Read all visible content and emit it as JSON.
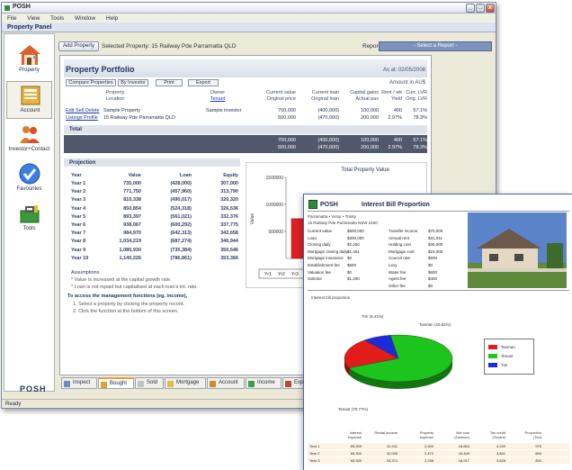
{
  "window": {
    "title": "POSH",
    "min": "_",
    "max": "□",
    "close": "x"
  },
  "menu": [
    "File",
    "View",
    "Tools",
    "Window",
    "Help"
  ],
  "panel": {
    "title": "Property Panel"
  },
  "sidebar": {
    "items": [
      {
        "label": "Property",
        "icon": "house-icon"
      },
      {
        "label": "Account",
        "icon": "account-book-icon"
      },
      {
        "label": "Investor+Contact",
        "icon": "people-icon"
      },
      {
        "label": "Favourites",
        "icon": "checkmark-icon"
      },
      {
        "label": "Tools",
        "icon": "toolbox-icon"
      }
    ],
    "logo": "POSH"
  },
  "toolbar": {
    "add_property": "Add Property",
    "selected_property": "Selected Property: 15 Railway Pde Parramatta QLD",
    "report_label": "Report:",
    "report_select": "- Select a Report -"
  },
  "portfolio": {
    "title": "Property Portfolio",
    "as_at": "As at: 02/05/2008",
    "amount_in": "Amount in AU$",
    "buttons": [
      "Compare Properties",
      "By Investor",
      "Print",
      "Export"
    ],
    "columns": {
      "property": "Property",
      "location": "Location",
      "owner": "Owner",
      "tenant": "Tenant",
      "current_value": "Current value",
      "original_price": "Original price",
      "current_loan": "Current loan",
      "original_loan": "Original loan",
      "capital_gains": "Capital gains",
      "actual_pav": "Actual pav",
      "rent_wk": "Rent / wk",
      "yield": "Yield",
      "curr_lvr": "Curr. LVR",
      "orig_lvr": "Orig. LVR"
    },
    "row": {
      "actions1": "Edit Sell Delete",
      "actions2": "Listings Profile",
      "property": "Sample Property",
      "location": "15 Railway Pde Parramatta QLD",
      "owner": "Sample investor",
      "current_value": "700,000",
      "original_price": "600,000",
      "current_loan": "(400,000)",
      "original_loan": "(470,000)",
      "capital_gains": "100,000",
      "actual_pav": "200,000",
      "rent_wk": "400",
      "yield": "2.97%",
      "curr_lvr": "57.1%",
      "orig_lvr": "78.3%"
    },
    "total": {
      "label": "Total",
      "current_value": "700,000",
      "original_price": "600,000",
      "current_loan": "(400,000)",
      "original_loan": "(470,000)",
      "capital_gains": "100,000",
      "actual_pav": "200,000",
      "rent_wk": "400",
      "yield": "2.97%",
      "curr_lvr": "57.1%",
      "orig_lvr": "78.3%"
    }
  },
  "projection": {
    "title": "Projection",
    "headers": [
      "Year",
      "Value",
      "Loan",
      "Equity"
    ],
    "rows": [
      [
        "Year 1",
        "735,000",
        "(428,000)",
        "307,000"
      ],
      [
        "Year 2",
        "771,750",
        "(457,960)",
        "313,790"
      ],
      [
        "Year 3",
        "810,338",
        "(490,017)",
        "320,320"
      ],
      [
        "Year 4",
        "850,854",
        "(524,318)",
        "326,536"
      ],
      [
        "Year 5",
        "893,397",
        "(561,021)",
        "332,376"
      ],
      [
        "Year 6",
        "938,067",
        "(600,292)",
        "337,775"
      ],
      [
        "Year 7",
        "984,970",
        "(642,313)",
        "342,658"
      ],
      [
        "Year 8",
        "1,034,219",
        "(687,274)",
        "346,944"
      ],
      [
        "Year 9",
        "1,085,930",
        "(735,384)",
        "350,546"
      ],
      [
        "Year 10",
        "1,140,226",
        "(786,861)",
        "353,366"
      ]
    ],
    "assumptions_title": "Assumptions",
    "assumptions": [
      "* Value is increased at the capital growth rate.",
      "* Loan is not repaid but capitalised at each loan's int. rate."
    ]
  },
  "management": {
    "title": "To access the management functions (eg. income),",
    "steps": [
      "1. Select a property by clicking the property record.",
      "2. Click the function at the bottom of this screen."
    ]
  },
  "chart_data": {
    "type": "bar",
    "title": "Total Property Value",
    "ylabel": "Value",
    "yticks": [
      "1500000",
      "1000000",
      "500000"
    ],
    "categories": [
      "Yr1",
      "Yr2",
      "Yr3"
    ],
    "values": [
      735000,
      771750,
      810338
    ],
    "ylim": [
      0,
      1500000
    ],
    "color": "#e02020"
  },
  "tabs": [
    {
      "label": "Inspect",
      "icon": "inspect-icon"
    },
    {
      "label": "Bought",
      "icon": "bought-icon",
      "active": true
    },
    {
      "label": "Sold",
      "icon": "sold-icon"
    },
    {
      "label": "Mortgage",
      "icon": "mortgage-icon"
    },
    {
      "label": "Account",
      "icon": "account-icon"
    },
    {
      "label": "Income",
      "icon": "income-icon"
    },
    {
      "label": "Expen",
      "icon": "expense-icon"
    }
  ],
  "status": "Ready",
  "report": {
    "brand": "POSH",
    "title": "Interest Bill Proportion",
    "address1": "Parramatta • Victor • Trinity",
    "address2": "15 Railway Pde Parramatta NSW 2150",
    "left_kv": [
      [
        "Current value",
        "$600,000"
      ],
      [
        "Loan",
        "$300,000"
      ],
      [
        "Closing daily",
        "$2,250"
      ],
      [
        "Mortgage closing daily",
        "$1,451"
      ],
      [
        "Mortgage insurance",
        "$0"
      ],
      [
        "Establishment fee",
        "$600"
      ],
      [
        "Valuation fee",
        "$0"
      ],
      [
        "Solicitor",
        "$1,200"
      ]
    ],
    "mid_kv": [
      [
        "Transfer income",
        "$70,000"
      ],
      [
        "Annual rent",
        "$31,011"
      ],
      [
        "Holding cost",
        "$40,000"
      ],
      [
        "Mortgage cost",
        "$23,000"
      ],
      [
        "Council rate",
        "$600"
      ],
      [
        "Levy",
        "$0"
      ],
      [
        "Water fee",
        "$600"
      ],
      [
        "Agent fee",
        "$400"
      ],
      [
        "Other fee",
        "$0"
      ]
    ],
    "pie_title": "Interest bill proportion",
    "pie_labels": [
      "Tim (8.41%)",
      "Taxman (20.82%)",
      "Tenant (70.77%)"
    ],
    "chart_data": {
      "type": "pie",
      "title": "Interest bill proportion",
      "slices": [
        {
          "name": "Tenant",
          "value": 70.77,
          "color": "#1ec41e"
        },
        {
          "name": "Taxman",
          "value": 20.82,
          "color": "#e21b1b"
        },
        {
          "name": "Tim",
          "value": 8.41,
          "color": "#1d2bd8"
        }
      ]
    },
    "legend": [
      "Taxman",
      "Tenant",
      "Tim"
    ],
    "table_headers": [
      "Interest expense",
      "Rental income",
      "Property expense",
      "Net cost (Taxman)",
      "Tax credit (Tenant)",
      "Proportion (Tim)"
    ],
    "table_rows": [
      [
        "Year 1",
        "65,300",
        "31,011",
        "2,400",
        "18,824",
        "4,240",
        "976"
      ],
      [
        "Year 2",
        "65,300",
        "32,095",
        "2,472",
        "18,449",
        "3,841",
        "894"
      ],
      [
        "Year 3",
        "65,300",
        "33,374",
        "2,236",
        "18,917",
        "3,628",
        "834"
      ]
    ]
  }
}
